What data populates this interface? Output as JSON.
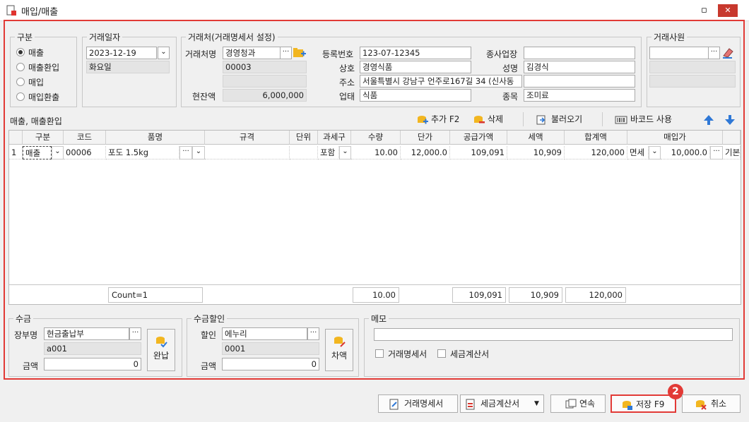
{
  "window": {
    "title": "매입/매출",
    "minimize_glyph": "▫",
    "close_glyph": "✕"
  },
  "category": {
    "legend": "구분",
    "options": [
      "매출",
      "매출환입",
      "매입",
      "매입환출"
    ],
    "selected": "매출"
  },
  "trade_date": {
    "legend": "거래일자",
    "date": "2023-12-19",
    "weekday": "화요일"
  },
  "partner": {
    "legend": "거래처(거래명세서 설정)",
    "name_label": "거래처명",
    "name_value": "경영청과",
    "code": "00003",
    "balance_label": "현잔액",
    "balance": "6,000,000",
    "reg_label": "등록번호",
    "reg_value": "123-07-12345",
    "company_label": "상호",
    "company_value": "경영식품",
    "address_label": "주소",
    "address_value": "서울특별시 강남구 언주로167길 34 (신사동",
    "biz_type_label": "업태",
    "biz_type_value": "식품",
    "workplace_label": "종사업장",
    "workplace_value": "",
    "rep_label": "성명",
    "rep_value": "김경식",
    "item_label": "종목",
    "item_value": "조미료"
  },
  "employee": {
    "legend": "거래사원",
    "value": ""
  },
  "toolbar": {
    "section_label": "매출, 매출환입",
    "add_label": "추가 F2",
    "delete_label": "삭제",
    "load_label": "불러오기",
    "barcode_label": "바코드 사용"
  },
  "table": {
    "columns": [
      "구분",
      "코드",
      "품명",
      "규격",
      "단위",
      "과세구",
      "수량",
      "단가",
      "공급가액",
      "세액",
      "합계액",
      "매입가"
    ],
    "row": {
      "num": "1",
      "type": "매출",
      "code": "00006",
      "name": "포도 1.5kg",
      "spec": "",
      "unit": "",
      "tax": "포함",
      "qty": "10.00",
      "price": "12,000.0",
      "supply": "109,091",
      "vat": "10,909",
      "total": "120,000",
      "purchase_tax": "면세",
      "purchase_price": "10,000.0",
      "extra": "기본"
    },
    "footer": {
      "count": "Count=1",
      "qty": "10.00",
      "supply": "109,091",
      "vat": "10,909",
      "total": "120,000"
    }
  },
  "receipt": {
    "legend": "수금",
    "ledger_label": "장부명",
    "ledger_value": "현금출납부",
    "ledger_code": "a001",
    "amount_label": "금액",
    "amount_value": "0",
    "button_label": "완납"
  },
  "discount": {
    "legend": "수금할인",
    "label": "할인",
    "value": "에누리",
    "code": "0001",
    "amount_label": "금액",
    "amount_value": "0",
    "button_label": "차액"
  },
  "memo": {
    "legend": "메모",
    "value": "",
    "chk_statement": "거래명세서",
    "chk_invoice": "세금계산서"
  },
  "bottom": {
    "statement_label": "거래명세서",
    "invoice_label": "세금계산서",
    "continuous_label": "연속",
    "save_label": "저장 F9",
    "cancel_label": "취소",
    "badge": "2"
  },
  "colors": {
    "highlight": "#e23a36",
    "accent_blue": "#2f78d6",
    "icon_yellow": "#f2b620"
  }
}
